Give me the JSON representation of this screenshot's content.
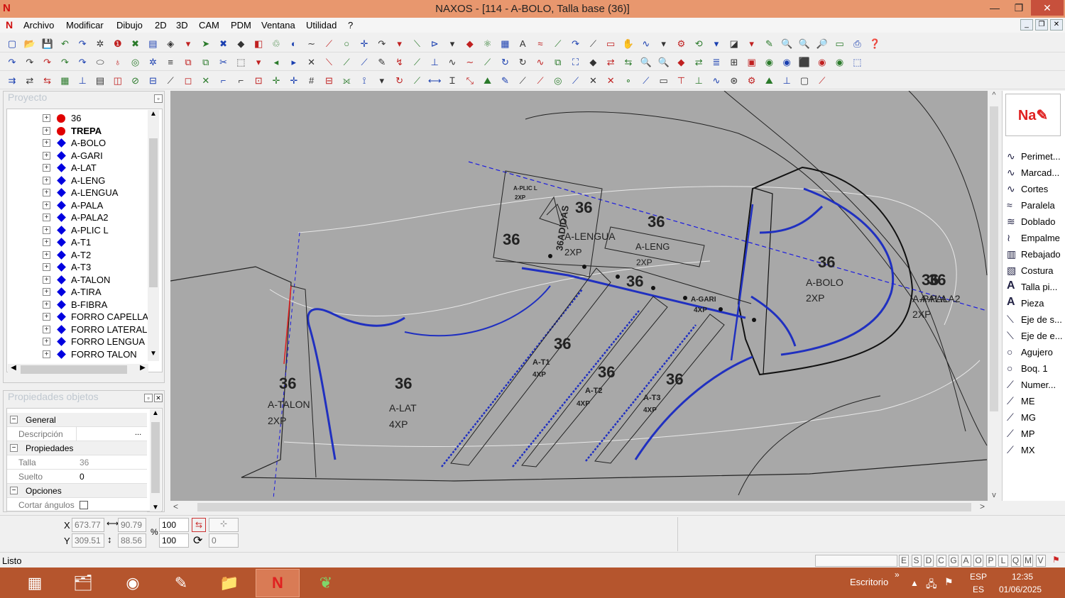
{
  "window": {
    "title": "NAXOS - [114 - A-BOLO, Talla base (36)]",
    "logo": "N",
    "minimize": "—",
    "restore": "❐",
    "close": "✕"
  },
  "menu": {
    "items": [
      "Archivo",
      "Modificar",
      "Dibujo",
      "2D",
      "3D",
      "CAM",
      "PDM",
      "Ventana",
      "Utilidad",
      "?"
    ],
    "mdi": [
      "_",
      "❐",
      "✕"
    ]
  },
  "project": {
    "title": "Proyecto",
    "items": [
      {
        "label": "36",
        "icon": "red-dot",
        "bold": false
      },
      {
        "label": "TREPA",
        "icon": "red-dot",
        "bold": true
      },
      {
        "label": "A-BOLO",
        "icon": "blue-diamond"
      },
      {
        "label": "A-GARI",
        "icon": "blue-diamond"
      },
      {
        "label": "A-LAT",
        "icon": "blue-diamond"
      },
      {
        "label": "A-LENG",
        "icon": "blue-diamond"
      },
      {
        "label": "A-LENGUA",
        "icon": "blue-diamond"
      },
      {
        "label": "A-PALA",
        "icon": "blue-diamond"
      },
      {
        "label": "A-PALA2",
        "icon": "blue-diamond"
      },
      {
        "label": "A-PLIC L",
        "icon": "blue-diamond"
      },
      {
        "label": "A-T1",
        "icon": "blue-diamond"
      },
      {
        "label": "A-T2",
        "icon": "blue-diamond"
      },
      {
        "label": "A-T3",
        "icon": "blue-diamond"
      },
      {
        "label": "A-TALON",
        "icon": "blue-diamond"
      },
      {
        "label": "A-TIRA",
        "icon": "blue-diamond"
      },
      {
        "label": "B-FIBRA",
        "icon": "blue-diamond"
      },
      {
        "label": "FORRO CAPELLAD.",
        "icon": "blue-diamond"
      },
      {
        "label": "FORRO LATERAL",
        "icon": "blue-diamond"
      },
      {
        "label": "FORRO LENGUA",
        "icon": "blue-diamond"
      },
      {
        "label": "FORRO TALON",
        "icon": "blue-diamond"
      }
    ]
  },
  "properties": {
    "title": "Propiedades objetos",
    "general": "General",
    "descripcion_label": "Descripción",
    "descripcion_btn": "...",
    "propiedades": "Propiedades",
    "talla_label": "Talla",
    "talla_value": "36",
    "suelto_label": "Suelto",
    "suelto_value": "0",
    "opciones": "Opciones",
    "cortar_label": "Cortar ángulos"
  },
  "canvas_labels": {
    "sizes": [
      "36",
      "36",
      "36",
      "36",
      "36",
      "36",
      "36",
      "36",
      "36",
      "36",
      "36",
      "36"
    ],
    "a_plic": "A-PLIC L",
    "a_plic_qty": "2XP",
    "a_lengua": "A-LENGUA",
    "a_lengua_qty": "2XP",
    "a_leng": "A-LENG",
    "a_leng_qty": "2XP",
    "a_bolo": "A-BOLO",
    "a_bolo_qty": "2XP",
    "a_pala": "A-PALA",
    "a_pala2": "A-PALA2",
    "a_pala_qty": "2XP",
    "a_gari": "A-GARI",
    "a_gari_qty": "4XP",
    "a_t1": "A-T1",
    "a_t1_qty": "4XP",
    "a_t2": "A-T2",
    "a_t2_qty": "4XP",
    "a_t3": "A-T3",
    "a_t3_qty": "4XP",
    "a_talon": "A-TALON",
    "a_talon_qty": "2XP",
    "a_lat": "A-LAT",
    "a_lat_qty": "4XP",
    "vertical_text": "36ADIDAS"
  },
  "tools": [
    {
      "label": "Perimet...",
      "icon": "curve-icon"
    },
    {
      "label": "Marcad...",
      "icon": "curve-icon"
    },
    {
      "label": "Cortes",
      "icon": "curve-icon"
    },
    {
      "label": "Paralela",
      "icon": "parallel-icon"
    },
    {
      "label": "Doblado",
      "icon": "fold-icon"
    },
    {
      "label": "Empalme",
      "icon": "join-icon"
    },
    {
      "label": "Rebajado",
      "icon": "skive-icon"
    },
    {
      "label": "Costura",
      "icon": "stitch-icon"
    },
    {
      "label": "Talla pi...",
      "icon": "text-a-icon"
    },
    {
      "label": "Pieza",
      "icon": "text-a-icon"
    },
    {
      "label": "Eje de s...",
      "icon": "axis-icon"
    },
    {
      "label": "Eje de e...",
      "icon": "axis-icon"
    },
    {
      "label": "Agujero",
      "icon": "circle-icon"
    },
    {
      "label": "Boq. 1",
      "icon": "circle-icon"
    },
    {
      "label": "Numer...",
      "icon": "line-icon"
    },
    {
      "label": "ME",
      "icon": "line-icon"
    },
    {
      "label": "MG",
      "icon": "line-icon"
    },
    {
      "label": "MP",
      "icon": "line-icon"
    },
    {
      "label": "MX",
      "icon": "line-icon"
    }
  ],
  "coords": {
    "x_label": "X",
    "y_label": "Y",
    "x": "673.77",
    "y": "309.51",
    "w": "90.79",
    "h": "88.56",
    "scale_x": "100",
    "scale_y": "100",
    "pct": "%",
    "angle": "0"
  },
  "status": {
    "text": "Listo",
    "letters": [
      "E",
      "S",
      "D",
      "C",
      "G",
      "A",
      "O",
      "P",
      "L",
      "Q",
      "M",
      "V"
    ]
  },
  "taskbar": {
    "escritorio": "Escritorio",
    "chevron": "»",
    "lang": "ESP",
    "lang2": "ES",
    "time": "12:35",
    "date": "01/06/2025"
  }
}
